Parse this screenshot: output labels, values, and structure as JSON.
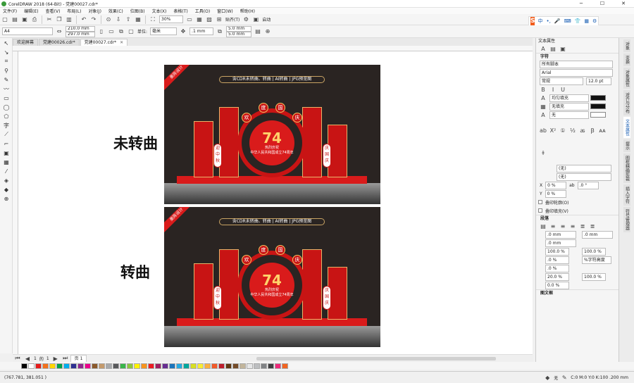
{
  "window": {
    "title": "CorelDRAW 2018 (64-Bit) - 党建00027.cdr*",
    "minimize": "─",
    "maximize": "☐",
    "close": "✕"
  },
  "menu": [
    "文件(F)",
    "编辑(E)",
    "查看(V)",
    "布局(L)",
    "对象(J)",
    "效果(C)",
    "位图(B)",
    "文本(X)",
    "表格(T)",
    "工具(O)",
    "窗口(W)",
    "帮助(H)"
  ],
  "toolbar1": {
    "zoom": "30%",
    "snap": "贴齐(T)",
    "launch": "启动"
  },
  "toolbar2": {
    "paper": "A4",
    "width": "210.0 mm",
    "height": "297.0 mm",
    "units_label": "单位:",
    "units": "毫米",
    "nudge": ".1 mm",
    "dup_x": "5.0 mm",
    "dup_y": "5.0 mm"
  },
  "ime": {
    "logo": "S",
    "items": [
      "中",
      "•,",
      "🎤",
      "⌨",
      "👕",
      "▦",
      "⚙"
    ]
  },
  "tabs": [
    {
      "label": "欢迎屏幕",
      "active": false
    },
    {
      "label": "党建00026.cdr*",
      "active": false
    },
    {
      "label": "党建00027.cdr*",
      "active": true
    }
  ],
  "canvas": {
    "label_top": "未转曲",
    "label_bottom": "转曲",
    "poster": {
      "ribbon": "美陈设计",
      "banner": "含CDR未转曲、转曲 | AI转曲 | JPG预览图",
      "arch_chars": [
        "欢",
        "度",
        "国",
        "庆"
      ],
      "number": "74",
      "subtitle": "热烈庆祝",
      "subtitle2": "中华人民共和国成立74周年",
      "left_vertical": "迎中秋",
      "right_vertical": "庆国庆"
    }
  },
  "pages": {
    "current": "1",
    "of": "的",
    "total": "1",
    "page_tab": "页 1"
  },
  "status": {
    "coords": "(767.781, 381.051 )",
    "fill": "无",
    "outline": "C:0 M:0 Y:0 K:100  .200 mm"
  },
  "docker": {
    "title": "文本属性",
    "char_section": "字符",
    "script": "所有脚本",
    "font": "Arial",
    "style": "常规",
    "size": "12.0 pt",
    "fill_type": "均匀填充",
    "bg_fill": "无填充",
    "outline": "无",
    "opt1": "(无)",
    "opt2": "(无)",
    "x_val": "0 %",
    "y_val": "0 %",
    "angle": ".0 °",
    "check1": "叠印轮廓(O)",
    "check2": "叠印填充(V)",
    "para_section": "段落",
    "indent1": ".0 mm",
    "indent2": ".0 mm",
    "indent3": ".0 mm",
    "spacing1": "100.0 %",
    "spacing2": "100.0 %",
    "spacing3": ".0 %",
    "spacing4": ".0 %",
    "char_height": "%字符高度",
    "word1": "20.0 %",
    "word2": "100.0 %",
    "word3": "0.0 %",
    "frame_section": "图文框"
  },
  "sidetabs": [
    "对象",
    "变换",
    "对象属性",
    "对齐与分布",
    "文本属性",
    "提示",
    "图框精确剪裁",
    "插入字符",
    "符号管理器"
  ],
  "palette": [
    "#000000",
    "#ffffff",
    "#e61b1b",
    "#f3711d",
    "#ffd600",
    "#00a14b",
    "#00aeef",
    "#2e3192",
    "#92278f",
    "#ec008c",
    "#8b5a2b",
    "#c49a6c",
    "#a7a9ac",
    "#58595b",
    "#39b54a",
    "#8dc63f",
    "#fff200",
    "#f7941d",
    "#ed1c24",
    "#9e1f63",
    "#662d91",
    "#1b75bc",
    "#27aae1",
    "#00a79d",
    "#d7df23",
    "#f9ed32",
    "#fbb040",
    "#f15a29",
    "#be1e2d",
    "#603913",
    "#754c29",
    "#c2b59b",
    "#e6e7e8",
    "#bcbec0",
    "#808285",
    "#414042",
    "#ee2a7b",
    "#f26522"
  ]
}
